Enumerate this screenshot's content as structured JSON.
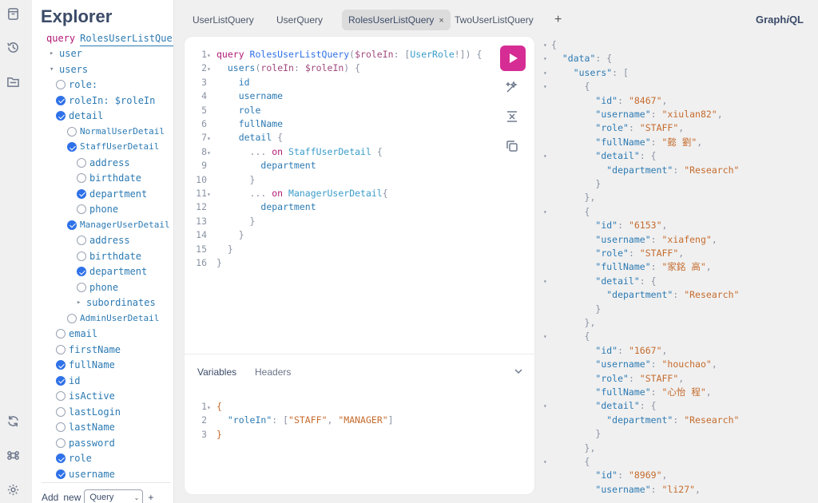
{
  "app": {
    "brand_main": "Graph",
    "brand_italic": "i",
    "brand_tail": "QL"
  },
  "rail": [
    "docs-icon",
    "history-icon",
    "explorer-icon",
    "refetch-icon",
    "shortcuts-icon",
    "settings-icon"
  ],
  "explorer": {
    "title": "Explorer",
    "query_kw": "query",
    "query_name": "RolesUserListQuery",
    "items": [
      {
        "type": "arrow",
        "indent": 0,
        "label": "user",
        "checked": false,
        "arrow": "▸"
      },
      {
        "type": "arrow",
        "indent": 0,
        "label": "users",
        "checked": false,
        "arrow": "▾"
      },
      {
        "type": "check",
        "indent": 1,
        "label": "role:",
        "checked": false
      },
      {
        "type": "check",
        "indent": 1,
        "label": "roleIn: $roleIn",
        "checked": true
      },
      {
        "type": "check",
        "indent": 1,
        "label": "detail",
        "checked": true
      },
      {
        "type": "check",
        "indent": 2,
        "label": "NormalUserDetail",
        "checked": false,
        "frag": true
      },
      {
        "type": "check",
        "indent": 2,
        "label": "StaffUserDetail",
        "checked": true,
        "frag": true
      },
      {
        "type": "check",
        "indent": 3,
        "label": "address",
        "checked": false
      },
      {
        "type": "check",
        "indent": 3,
        "label": "birthdate",
        "checked": false
      },
      {
        "type": "check",
        "indent": 3,
        "label": "department",
        "checked": true
      },
      {
        "type": "check",
        "indent": 3,
        "label": "phone",
        "checked": false
      },
      {
        "type": "check",
        "indent": 2,
        "label": "ManagerUserDetail",
        "checked": true,
        "frag": true
      },
      {
        "type": "check",
        "indent": 3,
        "label": "address",
        "checked": false
      },
      {
        "type": "check",
        "indent": 3,
        "label": "birthdate",
        "checked": false
      },
      {
        "type": "check",
        "indent": 3,
        "label": "department",
        "checked": true
      },
      {
        "type": "check",
        "indent": 3,
        "label": "phone",
        "checked": false
      },
      {
        "type": "arrow",
        "indent": 3,
        "label": "subordinates",
        "checked": false,
        "arrow": "▸"
      },
      {
        "type": "check",
        "indent": 2,
        "label": "AdminUserDetail",
        "checked": false,
        "frag": true
      },
      {
        "type": "check",
        "indent": 1,
        "label": "email",
        "checked": false
      },
      {
        "type": "check",
        "indent": 1,
        "label": "firstName",
        "checked": false
      },
      {
        "type": "check",
        "indent": 1,
        "label": "fullName",
        "checked": true
      },
      {
        "type": "check",
        "indent": 1,
        "label": "id",
        "checked": true
      },
      {
        "type": "check",
        "indent": 1,
        "label": "isActive",
        "checked": false
      },
      {
        "type": "check",
        "indent": 1,
        "label": "lastLogin",
        "checked": false
      },
      {
        "type": "check",
        "indent": 1,
        "label": "lastName",
        "checked": false
      },
      {
        "type": "check",
        "indent": 1,
        "label": "password",
        "checked": false
      },
      {
        "type": "check",
        "indent": 1,
        "label": "role",
        "checked": true
      },
      {
        "type": "check",
        "indent": 1,
        "label": "username",
        "checked": true
      }
    ],
    "add_label": "Add",
    "new_label": "new",
    "op_select": "Query",
    "add_plus": "+"
  },
  "tabs": [
    {
      "label": "UserListQuery",
      "active": false
    },
    {
      "label": "UserQuery",
      "active": false
    },
    {
      "label": "RolesUserListQuery",
      "active": true
    },
    {
      "label": "TwoUserListQuery",
      "active": false
    }
  ],
  "tab_close": "×",
  "tab_add": "+",
  "editor": {
    "lines": [
      {
        "n": "1",
        "fold": "▾",
        "toks": [
          [
            "c-kw",
            "query "
          ],
          [
            "c-def",
            "RolesUserListQuery"
          ],
          [
            "c-pun",
            "("
          ],
          [
            "c-var",
            "$roleIn"
          ],
          [
            "c-pun",
            ": ["
          ],
          [
            "c-type",
            "UserRole"
          ],
          [
            "c-pun",
            "!]) {"
          ]
        ]
      },
      {
        "n": "2",
        "fold": "▾",
        "toks": [
          [
            "c-pun",
            "  "
          ],
          [
            "c-fld",
            "users"
          ],
          [
            "c-pun",
            "("
          ],
          [
            "c-var",
            "roleIn"
          ],
          [
            "c-pun",
            ": "
          ],
          [
            "c-var",
            "$roleIn"
          ],
          [
            "c-pun",
            ") {"
          ]
        ]
      },
      {
        "n": "3",
        "fold": "",
        "toks": [
          [
            "c-pun",
            "    "
          ],
          [
            "c-fld",
            "id"
          ]
        ]
      },
      {
        "n": "4",
        "fold": "",
        "toks": [
          [
            "c-pun",
            "    "
          ],
          [
            "c-fld",
            "username"
          ]
        ]
      },
      {
        "n": "5",
        "fold": "",
        "toks": [
          [
            "c-pun",
            "    "
          ],
          [
            "c-fld",
            "role"
          ]
        ]
      },
      {
        "n": "6",
        "fold": "",
        "toks": [
          [
            "c-pun",
            "    "
          ],
          [
            "c-fld",
            "fullName"
          ]
        ]
      },
      {
        "n": "7",
        "fold": "▾",
        "toks": [
          [
            "c-pun",
            "    "
          ],
          [
            "c-fld",
            "detail"
          ],
          [
            "c-pun",
            " {"
          ]
        ]
      },
      {
        "n": "8",
        "fold": "▾",
        "toks": [
          [
            "c-pun",
            "      ... "
          ],
          [
            "c-kw",
            "on "
          ],
          [
            "c-type",
            "StaffUserDetail"
          ],
          [
            "c-pun",
            " {"
          ]
        ]
      },
      {
        "n": "9",
        "fold": "",
        "toks": [
          [
            "c-pun",
            "        "
          ],
          [
            "c-fld",
            "department"
          ]
        ]
      },
      {
        "n": "10",
        "fold": "",
        "toks": [
          [
            "c-pun",
            "      }"
          ]
        ]
      },
      {
        "n": "11",
        "fold": "▾",
        "toks": [
          [
            "c-pun",
            "      ... "
          ],
          [
            "c-kw",
            "on "
          ],
          [
            "c-type",
            "ManagerUserDetail"
          ],
          [
            "c-pun",
            "{"
          ]
        ]
      },
      {
        "n": "12",
        "fold": "",
        "toks": [
          [
            "c-pun",
            "        "
          ],
          [
            "c-fld",
            "department"
          ]
        ]
      },
      {
        "n": "13",
        "fold": "",
        "toks": [
          [
            "c-pun",
            "      }"
          ]
        ]
      },
      {
        "n": "14",
        "fold": "",
        "toks": [
          [
            "c-pun",
            "    }"
          ]
        ]
      },
      {
        "n": "15",
        "fold": "",
        "toks": [
          [
            "c-pun",
            "  }"
          ]
        ]
      },
      {
        "n": "16",
        "fold": "",
        "toks": [
          [
            "c-pun",
            "}"
          ]
        ]
      }
    ],
    "variables_tab": "Variables",
    "headers_tab": "Headers",
    "variables": [
      {
        "n": "1",
        "fold": "▾",
        "toks": [
          [
            "c-str",
            "{"
          ]
        ]
      },
      {
        "n": "2",
        "fold": "",
        "toks": [
          [
            "c-pun",
            "  "
          ],
          [
            "c-prop",
            "\"roleIn\""
          ],
          [
            "c-pun",
            ": ["
          ],
          [
            "c-str",
            "\"STAFF\""
          ],
          [
            "c-pun",
            ", "
          ],
          [
            "c-str",
            "\"MANAGER\""
          ],
          [
            "c-pun",
            "]"
          ]
        ]
      },
      {
        "n": "3",
        "fold": "",
        "toks": [
          [
            "c-str",
            "}"
          ]
        ]
      }
    ]
  },
  "result": {
    "lines": [
      {
        "fold": "▾",
        "toks": [
          [
            "c-pun",
            "{"
          ]
        ]
      },
      {
        "fold": "▾",
        "toks": [
          [
            "c-pun",
            "  "
          ],
          [
            "c-prop",
            "\"data\""
          ],
          [
            "c-pun",
            ": {"
          ]
        ]
      },
      {
        "fold": "▾",
        "toks": [
          [
            "c-pun",
            "    "
          ],
          [
            "c-prop",
            "\"users\""
          ],
          [
            "c-pun",
            ": ["
          ]
        ]
      },
      {
        "fold": "▾",
        "toks": [
          [
            "c-pun",
            "      {"
          ]
        ]
      },
      {
        "fold": "",
        "toks": [
          [
            "c-pun",
            "        "
          ],
          [
            "c-prop",
            "\"id\""
          ],
          [
            "c-pun",
            ": "
          ],
          [
            "c-str",
            "\"8467\""
          ],
          [
            "c-pun",
            ","
          ]
        ]
      },
      {
        "fold": "",
        "toks": [
          [
            "c-pun",
            "        "
          ],
          [
            "c-prop",
            "\"username\""
          ],
          [
            "c-pun",
            ": "
          ],
          [
            "c-str",
            "\"xiulan82\""
          ],
          [
            "c-pun",
            ","
          ]
        ]
      },
      {
        "fold": "",
        "toks": [
          [
            "c-pun",
            "        "
          ],
          [
            "c-prop",
            "\"role\""
          ],
          [
            "c-pun",
            ": "
          ],
          [
            "c-str",
            "\"STAFF\""
          ],
          [
            "c-pun",
            ","
          ]
        ]
      },
      {
        "fold": "",
        "toks": [
          [
            "c-pun",
            "        "
          ],
          [
            "c-prop",
            "\"fullName\""
          ],
          [
            "c-pun",
            ": "
          ],
          [
            "c-str",
            "\"懿 劉\""
          ],
          [
            "c-pun",
            ","
          ]
        ]
      },
      {
        "fold": "▾",
        "toks": [
          [
            "c-pun",
            "        "
          ],
          [
            "c-prop",
            "\"detail\""
          ],
          [
            "c-pun",
            ": {"
          ]
        ]
      },
      {
        "fold": "",
        "toks": [
          [
            "c-pun",
            "          "
          ],
          [
            "c-prop",
            "\"department\""
          ],
          [
            "c-pun",
            ": "
          ],
          [
            "c-str",
            "\"Research\""
          ]
        ]
      },
      {
        "fold": "",
        "toks": [
          [
            "c-pun",
            "        }"
          ]
        ]
      },
      {
        "fold": "",
        "toks": [
          [
            "c-pun",
            "      },"
          ]
        ]
      },
      {
        "fold": "▾",
        "toks": [
          [
            "c-pun",
            "      {"
          ]
        ]
      },
      {
        "fold": "",
        "toks": [
          [
            "c-pun",
            "        "
          ],
          [
            "c-prop",
            "\"id\""
          ],
          [
            "c-pun",
            ": "
          ],
          [
            "c-str",
            "\"6153\""
          ],
          [
            "c-pun",
            ","
          ]
        ]
      },
      {
        "fold": "",
        "toks": [
          [
            "c-pun",
            "        "
          ],
          [
            "c-prop",
            "\"username\""
          ],
          [
            "c-pun",
            ": "
          ],
          [
            "c-str",
            "\"xiafeng\""
          ],
          [
            "c-pun",
            ","
          ]
        ]
      },
      {
        "fold": "",
        "toks": [
          [
            "c-pun",
            "        "
          ],
          [
            "c-prop",
            "\"role\""
          ],
          [
            "c-pun",
            ": "
          ],
          [
            "c-str",
            "\"STAFF\""
          ],
          [
            "c-pun",
            ","
          ]
        ]
      },
      {
        "fold": "",
        "toks": [
          [
            "c-pun",
            "        "
          ],
          [
            "c-prop",
            "\"fullName\""
          ],
          [
            "c-pun",
            ": "
          ],
          [
            "c-str",
            "\"家銘 高\""
          ],
          [
            "c-pun",
            ","
          ]
        ]
      },
      {
        "fold": "▾",
        "toks": [
          [
            "c-pun",
            "        "
          ],
          [
            "c-prop",
            "\"detail\""
          ],
          [
            "c-pun",
            ": {"
          ]
        ]
      },
      {
        "fold": "",
        "toks": [
          [
            "c-pun",
            "          "
          ],
          [
            "c-prop",
            "\"department\""
          ],
          [
            "c-pun",
            ": "
          ],
          [
            "c-str",
            "\"Research\""
          ]
        ]
      },
      {
        "fold": "",
        "toks": [
          [
            "c-pun",
            "        }"
          ]
        ]
      },
      {
        "fold": "",
        "toks": [
          [
            "c-pun",
            "      },"
          ]
        ]
      },
      {
        "fold": "▾",
        "toks": [
          [
            "c-pun",
            "      {"
          ]
        ]
      },
      {
        "fold": "",
        "toks": [
          [
            "c-pun",
            "        "
          ],
          [
            "c-prop",
            "\"id\""
          ],
          [
            "c-pun",
            ": "
          ],
          [
            "c-str",
            "\"1667\""
          ],
          [
            "c-pun",
            ","
          ]
        ]
      },
      {
        "fold": "",
        "toks": [
          [
            "c-pun",
            "        "
          ],
          [
            "c-prop",
            "\"username\""
          ],
          [
            "c-pun",
            ": "
          ],
          [
            "c-str",
            "\"houchao\""
          ],
          [
            "c-pun",
            ","
          ]
        ]
      },
      {
        "fold": "",
        "toks": [
          [
            "c-pun",
            "        "
          ],
          [
            "c-prop",
            "\"role\""
          ],
          [
            "c-pun",
            ": "
          ],
          [
            "c-str",
            "\"STAFF\""
          ],
          [
            "c-pun",
            ","
          ]
        ]
      },
      {
        "fold": "",
        "toks": [
          [
            "c-pun",
            "        "
          ],
          [
            "c-prop",
            "\"fullName\""
          ],
          [
            "c-pun",
            ": "
          ],
          [
            "c-str",
            "\"心怡 程\""
          ],
          [
            "c-pun",
            ","
          ]
        ]
      },
      {
        "fold": "▾",
        "toks": [
          [
            "c-pun",
            "        "
          ],
          [
            "c-prop",
            "\"detail\""
          ],
          [
            "c-pun",
            ": {"
          ]
        ]
      },
      {
        "fold": "",
        "toks": [
          [
            "c-pun",
            "          "
          ],
          [
            "c-prop",
            "\"department\""
          ],
          [
            "c-pun",
            ": "
          ],
          [
            "c-str",
            "\"Research\""
          ]
        ]
      },
      {
        "fold": "",
        "toks": [
          [
            "c-pun",
            "        }"
          ]
        ]
      },
      {
        "fold": "",
        "toks": [
          [
            "c-pun",
            "      },"
          ]
        ]
      },
      {
        "fold": "▾",
        "toks": [
          [
            "c-pun",
            "      {"
          ]
        ]
      },
      {
        "fold": "",
        "toks": [
          [
            "c-pun",
            "        "
          ],
          [
            "c-prop",
            "\"id\""
          ],
          [
            "c-pun",
            ": "
          ],
          [
            "c-str",
            "\"8969\""
          ],
          [
            "c-pun",
            ","
          ]
        ]
      },
      {
        "fold": "",
        "toks": [
          [
            "c-pun",
            "        "
          ],
          [
            "c-prop",
            "\"username\""
          ],
          [
            "c-pun",
            ": "
          ],
          [
            "c-str",
            "\"li27\""
          ],
          [
            "c-pun",
            ","
          ]
        ]
      }
    ]
  }
}
